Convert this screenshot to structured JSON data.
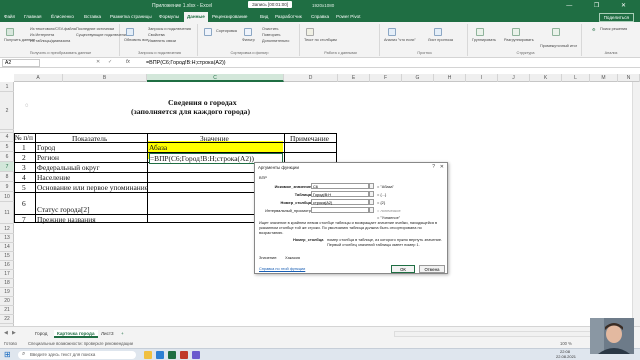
{
  "window": {
    "title": "Приложение 1.xlsx  -  Excel",
    "recording_badge": "Запись [00:01:00]",
    "resolution": "1920x1080",
    "controls": "— ❐ ✕"
  },
  "ribbon_tabs": [
    "Файл",
    "Главная",
    "Ёлисеенко",
    "Вставка",
    "Разметка страницы",
    "Формулы",
    "Данные",
    "Рецензирование",
    "Вид",
    "Разработчик",
    "Справка",
    "Power Pivot"
  ],
  "share_label": "Поделиться",
  "ribbon_groups": [
    "Получить и преобразовать данные",
    "Запросы и подключения",
    "Сортировка и фильтр",
    "Работа с данными",
    "Прогноз",
    "Структура",
    "Анализ"
  ],
  "ribbon_items": [
    "Получить данные",
    "Из текстового/CSV-файла",
    "Из Интернета",
    "Из таблицы/диапазона",
    "Последние источники",
    "Существующие подключения",
    "Обновить все",
    "Запросы и подключения",
    "Свойства",
    "Изменить связи",
    "Сортировка",
    "Фильтр",
    "Очистить",
    "Повторить",
    "Дополнительно",
    "Текст по столбцам",
    "Анализ \"что если\"",
    "Лист прогноза",
    "Группировать",
    "Разгруппировать",
    "Промежуточный итог",
    "Поиск решения"
  ],
  "formula_bar": {
    "name_box": "A2",
    "fx": "fx",
    "formula": "=ВПР(C6;Город!B:H;строка(A2))"
  },
  "columns": [
    "A",
    "B",
    "C",
    "D",
    "E",
    "F",
    "G",
    "H",
    "I",
    "J",
    "K",
    "L",
    "M",
    "N"
  ],
  "rows": [
    "1",
    "2",
    "3",
    "4",
    "5",
    "6",
    "7",
    "8",
    "9",
    "10",
    "11",
    "12",
    "13",
    "14",
    "15",
    "16",
    "17",
    "18",
    "19",
    "20",
    "21",
    "22",
    "23"
  ],
  "sheet": {
    "title_line1": "Сведения о  городах",
    "title_line2": "(заполняется для каждого города)",
    "hdr_num": "№ п/п",
    "hdr_indicator": "Показатель",
    "hdr_value": "Значение",
    "hdr_note": "Примечание",
    "r6_num": "1",
    "r6_name": "Город",
    "r6_value": "Абаза",
    "r7_num": "2",
    "r7_name": "Регион",
    "r7_value": "=ВПР(C6;Город!B:H;строка(A2))",
    "r8_num": "3",
    "r8_name": "Федеральный округ",
    "r9_num": "4",
    "r9_name": "Население",
    "r10_num": "5",
    "r10_name": "Основание или первое упоминание",
    "r11_num": "6",
    "r11_name": "Статус города[2]",
    "r12_num": "7",
    "r12_name": "Прежние названия"
  },
  "dialog": {
    "title": "Аргументы функции",
    "fn_name": "ВПР",
    "label1": "Искомое_значение",
    "value1": "C6",
    "result1": "= \"Абаза\"",
    "label2": "Таблица",
    "value2": "Город!B:H",
    "result2": "= {...}",
    "label3": "Номер_столбца",
    "value3": "строка(A2)",
    "result3": "= {2}",
    "label4": "Интервальный_просмотр",
    "value4": "",
    "result4": "= логическое",
    "result_unknown": "= \"Узнаеnoe\"",
    "description": "Ищет значение в крайнем левом столбце таблицы и возвращает значение ячейки, находящейся в указанном столбце той же строки. По умолчанию таблица должна быть отсортирована по возрастанию.",
    "arg_help_label": "Номер_столбца",
    "arg_help_text": "номер столбца в таблице, из которого нужно вернуть значение. Первый столбец значений таблицы имеет номер 1.",
    "value_label": "Значение:",
    "value_result": "Хакасия",
    "help_link": "Справка по этой функции",
    "ok": "ОК",
    "cancel": "Отмена"
  },
  "sheet_tabs": [
    "Город",
    "Карточка города",
    "Лист3"
  ],
  "add_sheet": "+",
  "status": {
    "ready": "Готово",
    "accessibility": "Специальные возможности: проверьте рекомендации",
    "zoom": "100 %"
  },
  "taskbar": {
    "search_placeholder": "Введите здесь текст для поиска",
    "time": "22:08",
    "date": "22.08.2021"
  },
  "colors": {
    "excel_green": "#1f6e43",
    "highlight_yellow": "#ffff00"
  }
}
